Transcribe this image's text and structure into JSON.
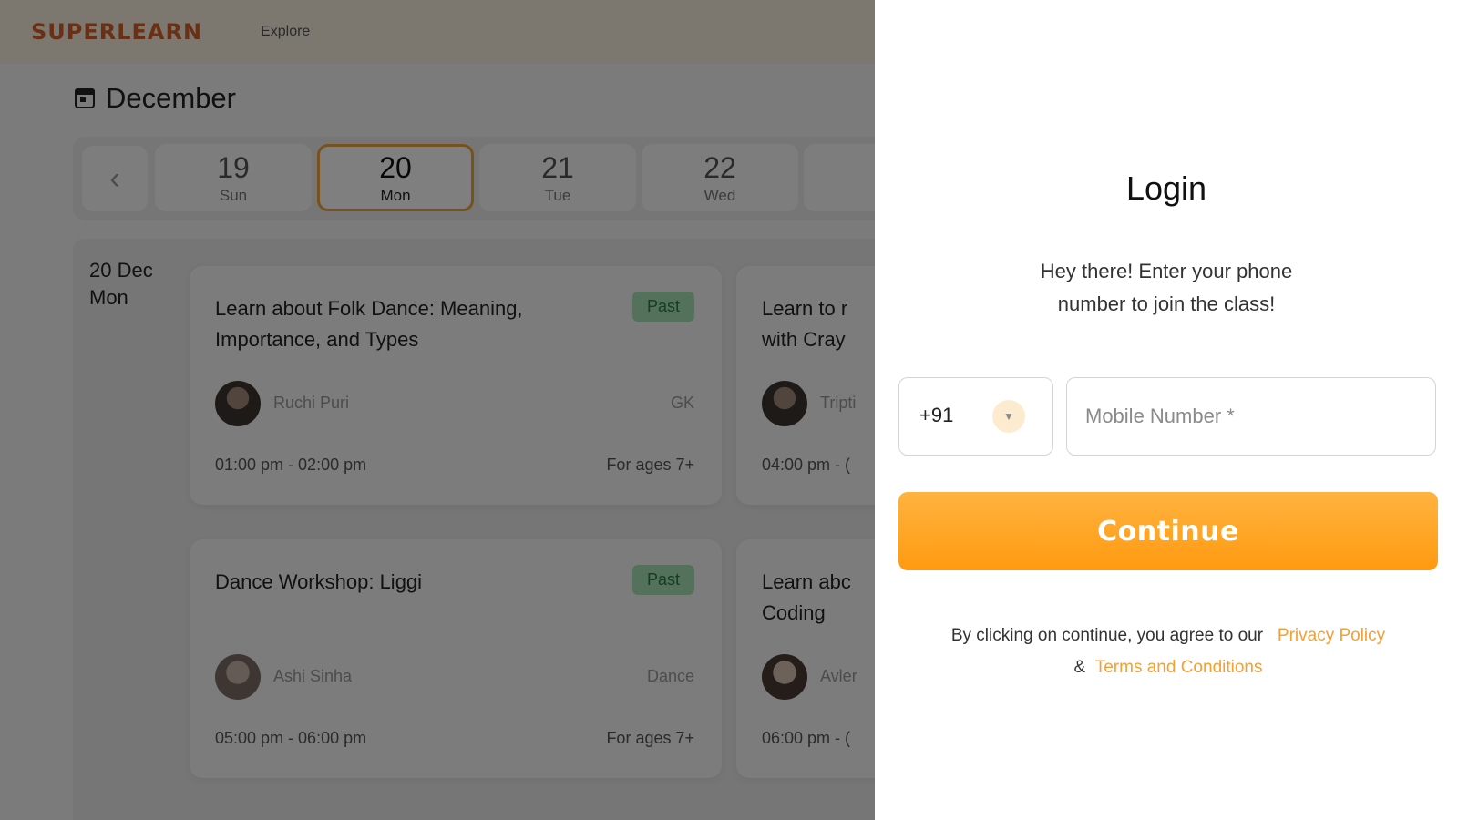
{
  "header": {
    "logo": "SUPERLEARN",
    "nav_explore": "Explore"
  },
  "calendar": {
    "month": "December",
    "days": [
      {
        "num": "19",
        "dow": "Sun"
      },
      {
        "num": "20",
        "dow": "Mon",
        "selected": true
      },
      {
        "num": "21",
        "dow": "Tue"
      },
      {
        "num": "22",
        "dow": "Wed"
      }
    ]
  },
  "schedule": {
    "date": "20 Dec",
    "weekday": "Mon",
    "cards": [
      {
        "title": "Learn about Folk Dance: Meaning, Importance, and Types",
        "badge": "Past",
        "teacher": "Ruchi Puri",
        "subject": "GK",
        "time": "01:00 pm - 02:00 pm",
        "ages": "For ages 7+"
      },
      {
        "title": "Learn to r… with Cray…",
        "title_l1": "Learn to r",
        "title_l2": "with Cray",
        "teacher": "Tripti",
        "time": "04:00 pm - ("
      },
      {
        "title": "Dance Workshop: Liggi",
        "badge": "Past",
        "teacher": "Ashi Sinha",
        "subject": "Dance",
        "time": "05:00 pm - 06:00 pm",
        "ages": "For ages 7+"
      },
      {
        "title_l1": "Learn abc",
        "title_l2": "Coding",
        "teacher": "Avler",
        "time": "06:00 pm - ("
      }
    ]
  },
  "login": {
    "title": "Login",
    "subtitle_l1": "Hey there! Enter your phone",
    "subtitle_l2": "number to join the class!",
    "country_code": "+91",
    "phone_placeholder": "Mobile Number *",
    "continue_label": "Continue",
    "terms_prefix": "By clicking on continue, you agree to our",
    "privacy_label": "Privacy Policy",
    "amp": "&",
    "terms_label": "Terms and Conditions"
  },
  "colors": {
    "accent": "#ff9a10",
    "brand": "#d4612a",
    "past_badge": "#a6e3b6"
  }
}
